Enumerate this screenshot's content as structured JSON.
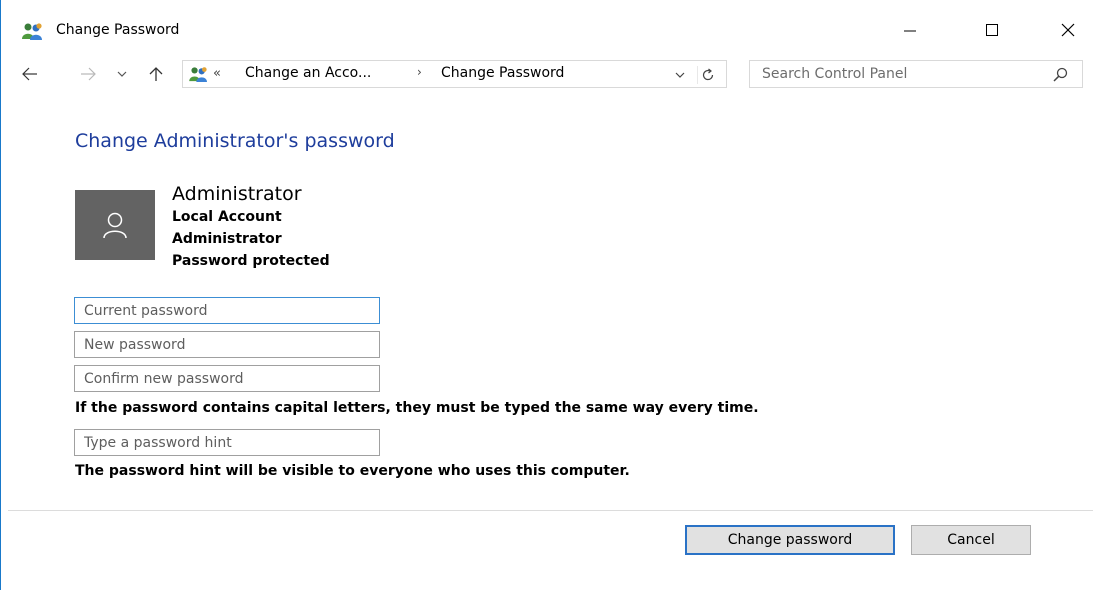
{
  "window": {
    "title": "Change Password",
    "accent_color": "#1979ca"
  },
  "navigation": {
    "breadcrumb_overflow": "«",
    "breadcrumbs": [
      "Change an Acco...",
      "Change Password"
    ],
    "breadcrumb_separator": "›",
    "search_placeholder": "Search Control Panel"
  },
  "main": {
    "heading": "Change Administrator's password",
    "heading_color": "#1e3d9c",
    "account": {
      "name": "Administrator",
      "details": [
        "Local Account",
        "Administrator",
        "Password protected"
      ]
    },
    "fields": {
      "current_placeholder": "Current password",
      "new_placeholder": "New password",
      "confirm_placeholder": "Confirm new password",
      "hint_placeholder": "Type a password hint"
    },
    "notes": {
      "capitals": "If the password contains capital letters, they must be typed the same way every time.",
      "hint_visibility": "The password hint will be visible to everyone who uses this computer."
    }
  },
  "buttons": {
    "change_password": "Change password",
    "cancel": "Cancel"
  }
}
